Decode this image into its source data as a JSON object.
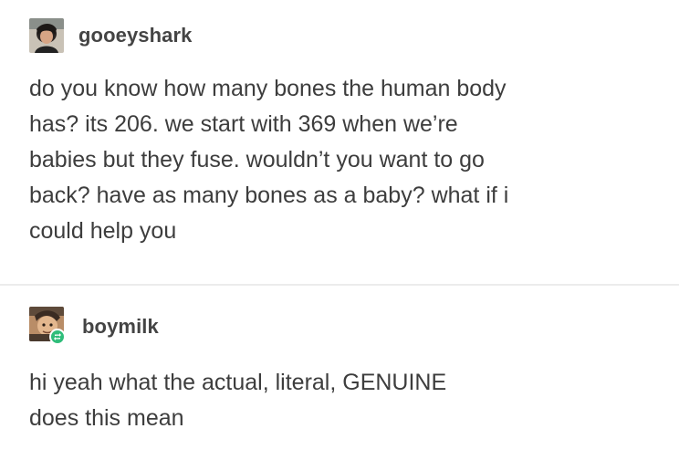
{
  "posts": [
    {
      "username": "gooeyshark",
      "avatar_icon": "user-avatar-icon",
      "text": "do you know how many bones the human body\nhas? its 206. we start with 369 when we’re\nbabies but they fuse. wouldn’t you want to go\nback? have as many bones as a baby? what if i\ncould help you"
    },
    {
      "username": "boymilk",
      "avatar_icon": "user-avatar-icon",
      "badge_icon": "reblog-icon",
      "text": "hi yeah what the actual, literal, GENUINE\ndoes this mean"
    }
  ],
  "colors": {
    "text": "#3d3d3d",
    "username": "#444444",
    "reblog_badge": "#2fbd7a",
    "divider": "#ececec"
  }
}
